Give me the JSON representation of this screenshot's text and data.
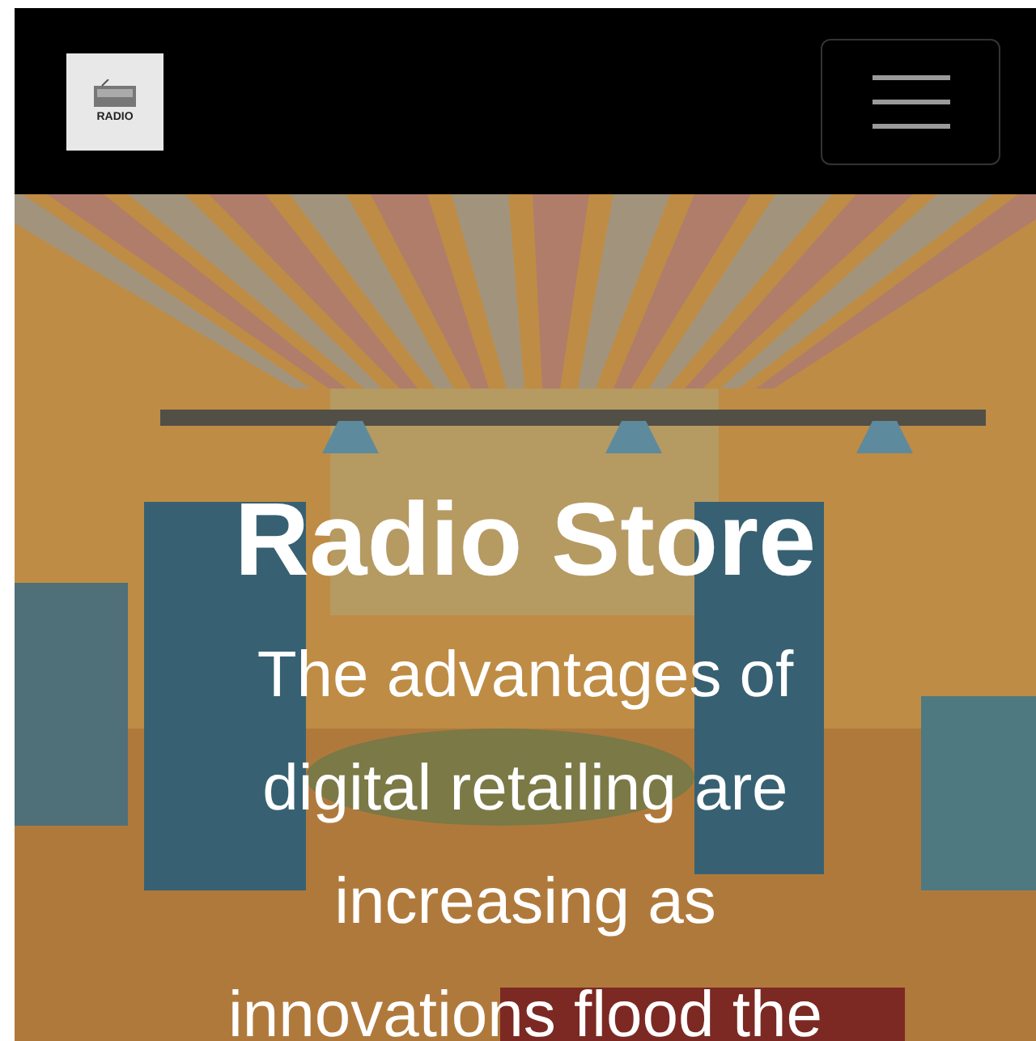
{
  "navbar": {
    "logo_text": "RADIO"
  },
  "hero": {
    "title": "Radio Store",
    "lines": [
      "The advantages of",
      "digital retailing are",
      "increasing as",
      "innovations flood the"
    ]
  }
}
